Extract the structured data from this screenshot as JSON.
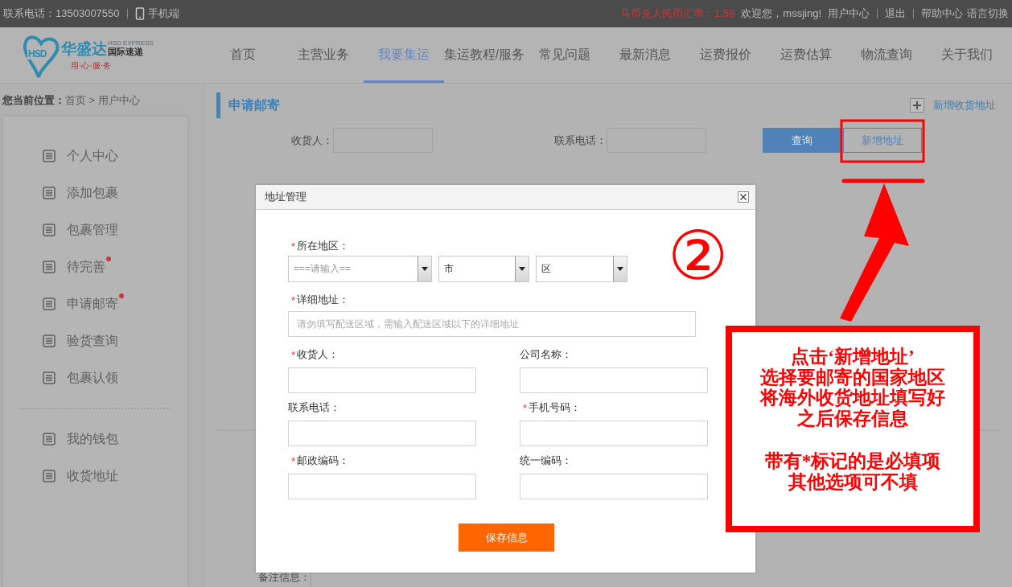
{
  "top_bar": {
    "phone": "联系电话：13503007550",
    "mobile": "手机端",
    "rate": "马币兑人民币汇率：1.58",
    "welcome": "欢迎您，mssjing!",
    "links": [
      "用户中心",
      "退出",
      "帮助中心"
    ],
    "language": "语言切换"
  },
  "logo": {
    "mark": "HSD",
    "name": "华盛达",
    "english": "HSD EXPRESS",
    "subtitle": "国际速递",
    "slogan": "用·心·服·务"
  },
  "nav": [
    {
      "label": "首页",
      "selected": false
    },
    {
      "label": "主营业务",
      "selected": false
    },
    {
      "label": "我要集运",
      "selected": true
    },
    {
      "label": "集运教程/服务",
      "selected": false
    },
    {
      "label": "常见问题",
      "selected": false
    },
    {
      "label": "最新消息",
      "selected": false
    },
    {
      "label": "运费报价",
      "selected": false
    },
    {
      "label": "运费估算",
      "selected": false
    },
    {
      "label": "物流查询",
      "selected": false
    },
    {
      "label": "关于我们",
      "selected": false
    }
  ],
  "breadcrumb": {
    "label": "您当前位置：",
    "trail": "首页 > 用户中心"
  },
  "sidebar": {
    "items": [
      {
        "label": "个人中心",
        "notice": false
      },
      {
        "label": "添加包裹",
        "notice": false
      },
      {
        "label": "包裹管理",
        "notice": false
      },
      {
        "label": "待完善",
        "notice": true
      },
      {
        "label": "申请邮寄",
        "notice": true
      },
      {
        "label": "验货查询",
        "notice": false
      },
      {
        "label": "包裹认领",
        "notice": false
      }
    ],
    "more_items": [
      {
        "label": "我的钱包",
        "notice": false
      },
      {
        "label": "收货地址",
        "notice": false
      }
    ]
  },
  "main": {
    "title": "申请邮寄",
    "add_link": "新增收货地址",
    "filters": [
      {
        "label": "收货人："
      },
      {
        "label": "联系电话："
      }
    ],
    "buttons": [
      {
        "label": "查询",
        "kind": "primary"
      },
      {
        "label": "新增地址",
        "kind": "outline"
      }
    ],
    "remark_label": "备注信息："
  },
  "dialog": {
    "title": "地址管理",
    "region": {
      "mark": "*",
      "label": "所在地区：",
      "selects": [
        {
          "placeholder": "===请输入=="
        },
        {
          "value": "市"
        },
        {
          "value": "区"
        }
      ]
    },
    "address": {
      "mark": "*",
      "label": "详细地址：",
      "placeholder": "请勿填写配送区域，需输入配送区域以下的详细地址"
    },
    "fields": [
      {
        "mark": "*",
        "label": "收货人："
      },
      {
        "label": "公司名称："
      },
      {
        "label": "联系电话："
      },
      {
        "mark": "*",
        "label": "手机号码："
      },
      {
        "mark": "*",
        "label": "邮政编码："
      },
      {
        "label": "统一编码："
      }
    ],
    "save": "保存信息"
  },
  "annotation": {
    "step": "②",
    "note": [
      [
        "点击‘新增地址’",
        "选择要邮寄的国家地区",
        "将海外收货地址填写好",
        "之后保存信息"
      ],
      [
        "带有*标记的是必填项",
        "其他选项可不填"
      ]
    ]
  }
}
